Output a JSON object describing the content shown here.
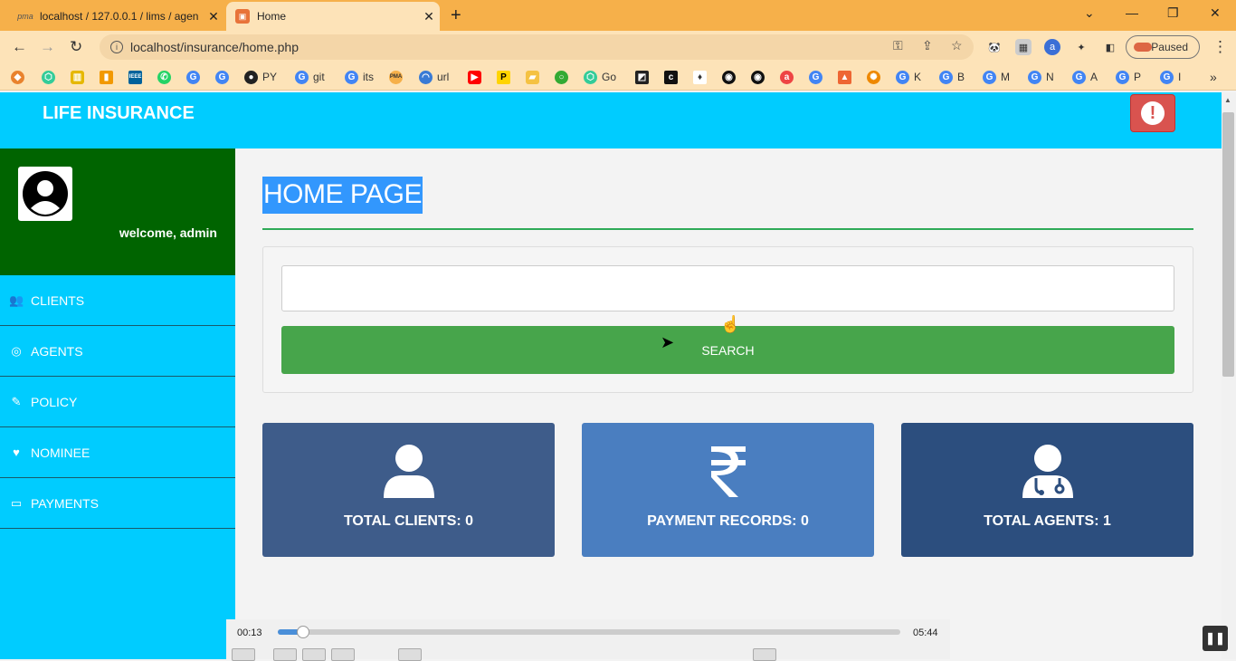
{
  "browser": {
    "tabs": [
      {
        "label": "localhost / 127.0.0.1 / lims / agen",
        "favicon": "pma-icon"
      },
      {
        "label": "Home",
        "favicon": "html-icon"
      }
    ],
    "address": "localhost/insurance/home.php",
    "profile_status": "Paused",
    "bookmarks": [
      {
        "label": "",
        "icon": "G"
      },
      {
        "label": "",
        "icon": "G"
      },
      {
        "label": "PY",
        "icon": "github"
      },
      {
        "label": "git",
        "icon": "G"
      },
      {
        "label": "its",
        "icon": "G"
      },
      {
        "label": "url",
        "icon": "wifi"
      },
      {
        "label": "Go",
        "icon": "hex"
      },
      {
        "label": "K",
        "icon": "G"
      },
      {
        "label": "B",
        "icon": "G"
      },
      {
        "label": "M",
        "icon": "G"
      },
      {
        "label": "N",
        "icon": "G"
      },
      {
        "label": "A",
        "icon": "G"
      },
      {
        "label": "P",
        "icon": "G"
      },
      {
        "label": "I",
        "icon": "G"
      }
    ]
  },
  "header": {
    "brand": "LIFE INSURANCE",
    "alert_icon": "exclamation-circle-icon"
  },
  "sidebar": {
    "welcome": "welcome, admin",
    "items": [
      {
        "label": "CLIENTS",
        "icon": "users-icon"
      },
      {
        "label": "AGENTS",
        "icon": "globe-icon"
      },
      {
        "label": "POLICY",
        "icon": "edit-icon"
      },
      {
        "label": "NOMINEE",
        "icon": "heart-icon"
      },
      {
        "label": "PAYMENTS",
        "icon": "credit-card-icon"
      }
    ]
  },
  "main": {
    "title": "HOME PAGE",
    "search": {
      "value": "",
      "placeholder": "",
      "button_label": "SEARCH"
    },
    "cards": [
      {
        "label": "TOTAL CLIENTS: 0",
        "icon": "user-icon",
        "color": "#3e5c8a"
      },
      {
        "label": "PAYMENT RECORDS: 0",
        "icon": "rupee-icon",
        "color": "#4a7ec0"
      },
      {
        "label": "TOTAL AGENTS: 1",
        "icon": "user-doctor-icon",
        "color": "#2c4e7e"
      }
    ]
  },
  "player": {
    "current_time": "00:13",
    "total_time": "05:44",
    "progress": 0.04
  }
}
